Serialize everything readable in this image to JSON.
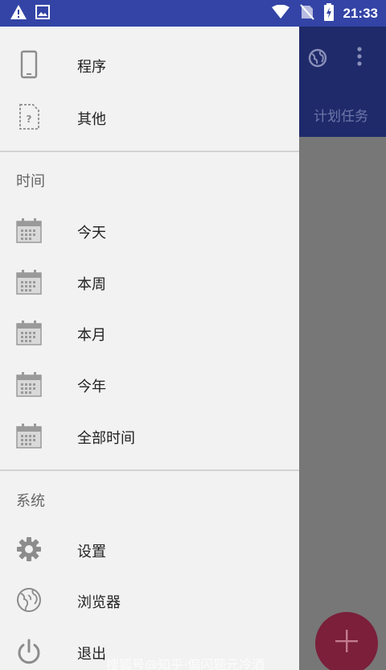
{
  "status_bar": {
    "time": "21:33"
  },
  "background_app": {
    "tab_label": "计划任务"
  },
  "drawer": {
    "items_top": [
      {
        "label": "程序",
        "icon": "phone-icon"
      },
      {
        "label": "其他",
        "icon": "unknown-file-icon"
      }
    ],
    "section_time": {
      "title": "时间",
      "items": [
        {
          "label": "今天",
          "icon": "calendar-icon"
        },
        {
          "label": "本周",
          "icon": "calendar-icon"
        },
        {
          "label": "本月",
          "icon": "calendar-icon"
        },
        {
          "label": "今年",
          "icon": "calendar-icon"
        },
        {
          "label": "全部时间",
          "icon": "calendar-icon"
        }
      ]
    },
    "section_system": {
      "title": "系统",
      "items": [
        {
          "label": "设置",
          "icon": "gear-icon"
        },
        {
          "label": "浏览器",
          "icon": "globe-icon"
        },
        {
          "label": "退出",
          "icon": "power-icon"
        }
      ]
    }
  },
  "watermark": "搜狐号@知乎·偏闪题元冷酒",
  "colors": {
    "status_bar": "#3344a6",
    "app_bar": "#1f2a6b",
    "drawer_bg": "#f2f2f2",
    "fab": "#7b1f3a"
  }
}
